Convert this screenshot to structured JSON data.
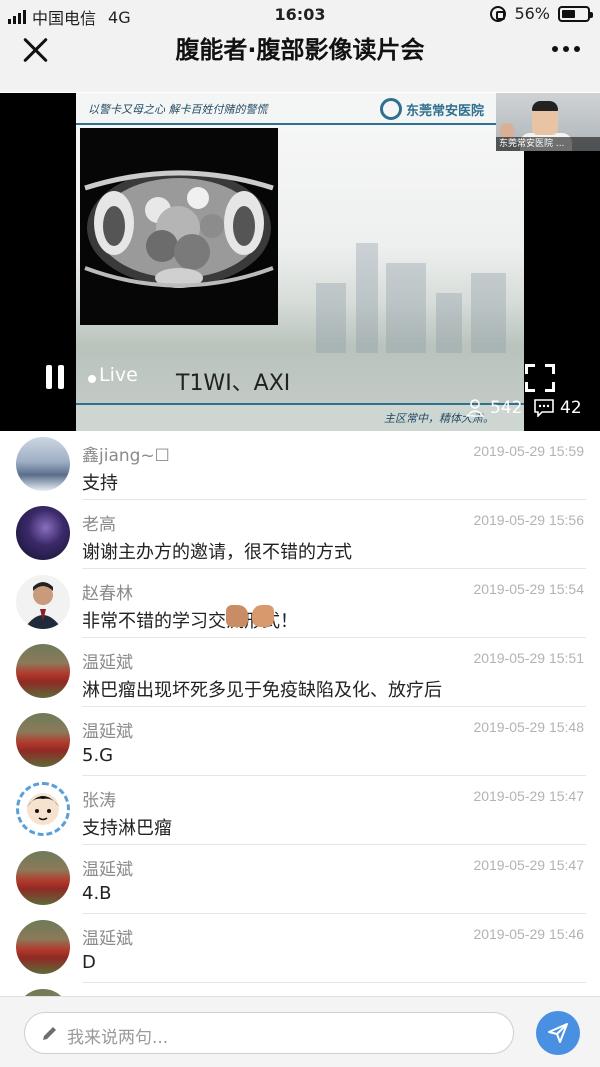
{
  "status_bar": {
    "carrier": "中国电信",
    "network": "4G",
    "time": "16:03",
    "battery": "56%",
    "battery_level": 0.56
  },
  "header": {
    "title": "腹能者·腹部影像读片会"
  },
  "video": {
    "slide_motto": "以警卡又母之心 解卡百姓付赌的警慌",
    "hospital_name": "东莞常安医院",
    "pip_label": "东莞常安医院 ...",
    "slide_caption": "T1WI、AXI",
    "live_label": "Live",
    "slide_footer": "主区常中，精体大肃。",
    "viewer_count": "542",
    "comment_count": "42"
  },
  "comments": [
    {
      "name": "鑫jiang~☐",
      "time": "2019-05-29 15:59",
      "text": "支持",
      "avatar": "winter-road"
    },
    {
      "name": "老高",
      "time": "2019-05-29 15:56",
      "text": "谢谢主办方的邀请，很不错的方式",
      "avatar": "galaxy"
    },
    {
      "name": "赵春林",
      "time": "2019-05-29 15:54",
      "text": "非常不错的学习交流形式！",
      "avatar": "person-portrait"
    },
    {
      "name": "温延斌",
      "time": "2019-05-29 15:51",
      "text": "淋巴瘤出现坏死多见于免疫缺陷及化、放疗后",
      "avatar": "tulip-field"
    },
    {
      "name": "温延斌",
      "time": "2019-05-29 15:48",
      "text": "5.G",
      "avatar": "tulip-field"
    },
    {
      "name": "张涛",
      "time": "2019-05-29 15:47",
      "text": "支持淋巴瘤",
      "avatar": "cartoon-face"
    },
    {
      "name": "温延斌",
      "time": "2019-05-29 15:47",
      "text": "4.B",
      "avatar": "tulip-field"
    },
    {
      "name": "温延斌",
      "time": "2019-05-29 15:46",
      "text": "D",
      "avatar": "tulip-field"
    }
  ],
  "input": {
    "placeholder": "我来说两句..."
  },
  "colors": {
    "accent": "#4a90e2",
    "time_gray": "#b3b3b3",
    "name_gray": "#8a8a8a"
  }
}
